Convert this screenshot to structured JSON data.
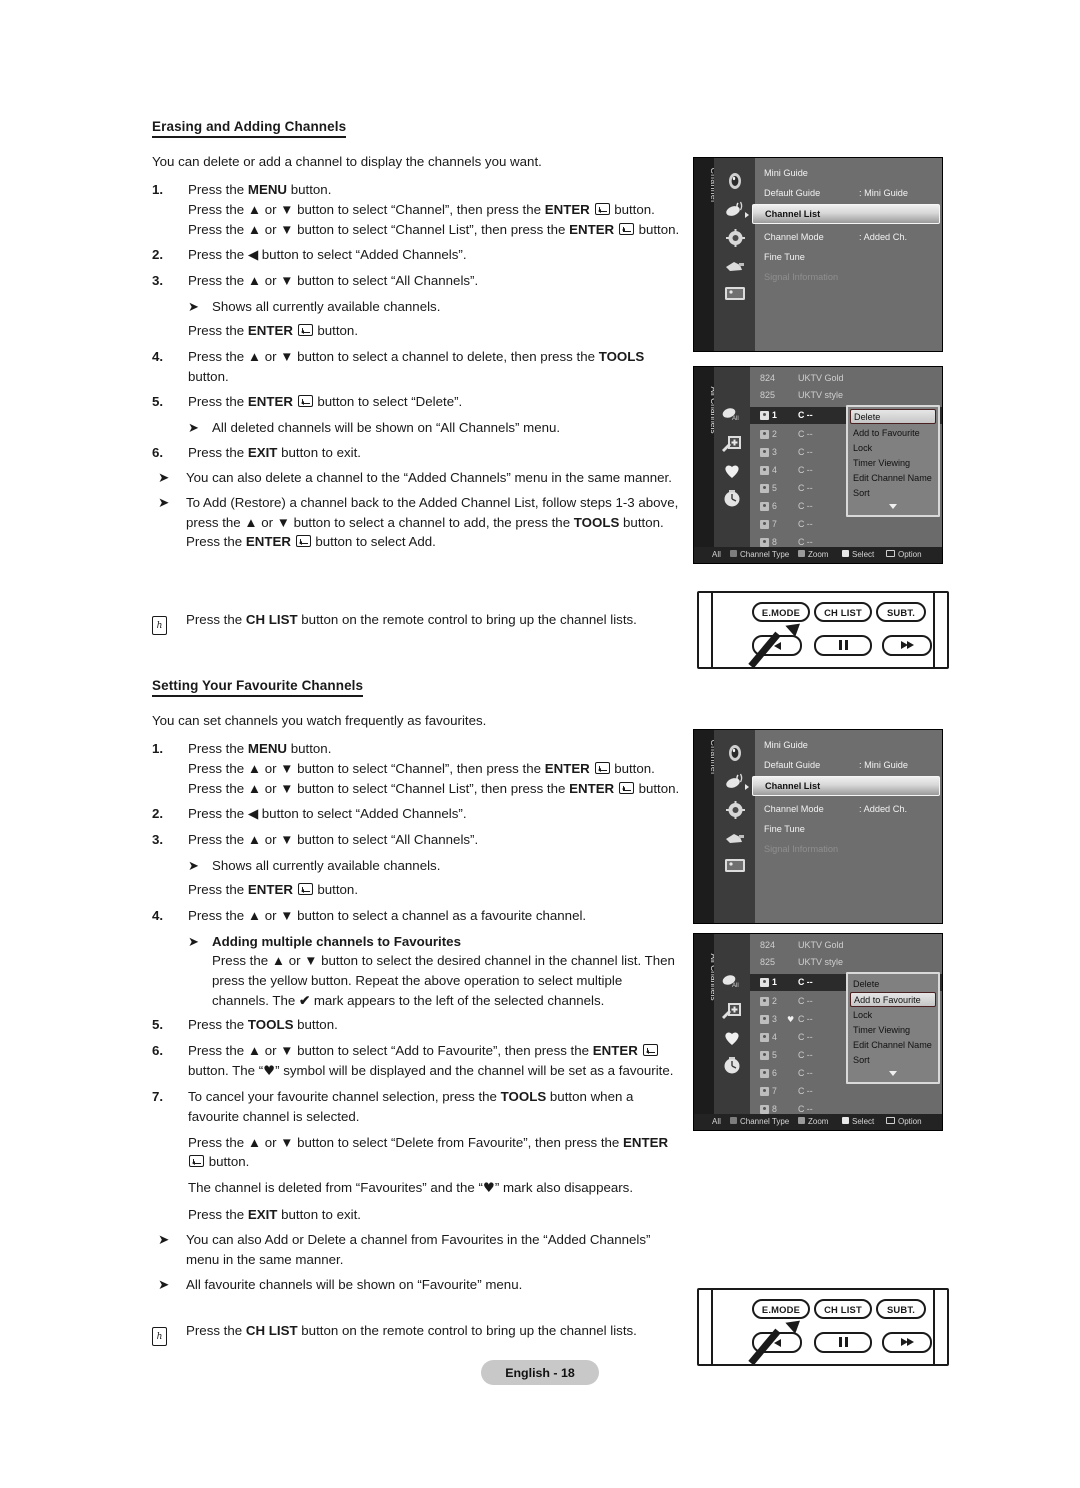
{
  "document": {
    "footer_label": "English - 18"
  },
  "section1": {
    "heading": "Erasing and Adding Channels",
    "intro": "You can delete or add a channel to display the channels you want.",
    "steps": [
      {
        "num": "1.",
        "lines": [
          "Press the MENU button.",
          "Press the ▲ or ▼ button to select “Channel”, then press the ENTER ↵ button. Press the ▲ or ▼ button to select “Channel List”, then press the ENTER ↵ button."
        ]
      },
      {
        "num": "2.",
        "lines": [
          "Press the ◀ button to select “Added Channels”."
        ]
      },
      {
        "num": "3.",
        "lines": [
          "Press the ▲ or ▼ button to select “All Channels”."
        ]
      },
      {
        "num": "4.",
        "lines": [
          "Press the ▲ or ▼ button to select a channel to delete, then press the TOOLS button."
        ]
      },
      {
        "num": "5.",
        "lines": [
          "Press the ENTER ↵ button to select “Delete”."
        ]
      },
      {
        "num": "6.",
        "lines": [
          "Press the EXIT button to exit."
        ]
      }
    ],
    "sub_step3_note": "Shows all currently available channels.",
    "sub_step3_after": "Press the ENTER ↵ button.",
    "sub_step5_note": "All deleted channels will be shown on “All Channels” menu.",
    "notes": [
      "You can also delete a channel to the “Added Channels” menu in the same manner.",
      "To Add (Restore) a channel back to the Added Channel List, follow steps 1-3 above, press the ▲ or ▼ button to select a channel to add, the press the TOOLS button. Press the ENTER ↵ button to select Add."
    ],
    "chlist_note": "Press the CH LIST button on the remote control to bring up the channel lists."
  },
  "section2": {
    "heading": "Setting Your Favourite Channels",
    "intro": "You can set channels you watch frequently as favourites.",
    "steps": [
      {
        "num": "1.",
        "lines": [
          "Press the MENU button.",
          "Press the ▲ or ▼ button to select “Channel”, then press the ENTER ↵ button. Press the ▲ or ▼ button to select “Channel List”, then press the ENTER ↵ button."
        ]
      },
      {
        "num": "2.",
        "lines": [
          "Press the ◀ button to select “Added Channels”."
        ]
      },
      {
        "num": "3.",
        "lines": [
          "Press the ▲ or ▼ button to select “All Channels”."
        ]
      },
      {
        "num": "4.",
        "lines": [
          "Press the ▲ or ▼ button to select a channel as a favourite channel."
        ]
      },
      {
        "num": "5.",
        "lines": [
          "Press the TOOLS button."
        ]
      },
      {
        "num": "6.",
        "lines": [
          "Press the ▲ or ▼ button to select “Add to Favourite”, then press the ENTER ↵ button. The “♥” symbol will be displayed and the channel will be set as a favourite."
        ]
      },
      {
        "num": "7.",
        "lines": [
          "To cancel your favourite channel selection, press the TOOLS button when a favourite channel is selected."
        ]
      }
    ],
    "sub_step3_note": "Shows all currently available channels.",
    "sub_step3_after": "Press the ENTER ↵ button.",
    "sub_step4_title": "Adding multiple channels to Favourites",
    "sub_step4_body": "Press the ▲ or ▼ button to select the desired channel in the channel list. Then press the yellow button. Repeat the above operation to select multiple channels. The ✔ mark appears to the left of the selected channels.",
    "step7_follow1": "Press the ▲ or ▼ button to select “Delete from Favourite”, then press the ENTER ↵ button.",
    "step7_follow2": "The channel is deleted from “Favourites” and the “♥” mark also disappears.",
    "step7_follow3": "Press the EXIT button to exit.",
    "notes": [
      "You can also Add or Delete a channel from Favourites in the “Added Channels” menu in the same manner.",
      "All favourite channels will be shown on “Favourite” menu."
    ],
    "chlist_note": "Press the CH LIST button on the remote control to bring up the channel lists."
  },
  "osd_menu": {
    "tab_label": "Channel",
    "icons": [
      "tv-guide-icon",
      "antenna-icon",
      "gear-icon",
      "plug-icon",
      "picture-icon"
    ],
    "rows": [
      {
        "label": "Mini Guide",
        "value": "",
        "state": "normal"
      },
      {
        "label": "Default Guide",
        "value": ": Mini Guide",
        "state": "normal"
      },
      {
        "label": "Channel List",
        "value": "",
        "state": "selected"
      },
      {
        "label": "Channel Mode",
        "value": ": Added Ch.",
        "state": "normal"
      },
      {
        "label": "Fine Tune",
        "value": "",
        "state": "normal"
      },
      {
        "label": "Signal Information",
        "value": "",
        "state": "disabled"
      }
    ]
  },
  "osd_list": {
    "tab_label": "All Channels",
    "icons": [
      "all-channels-icon",
      "added-channels-icon",
      "favourite-icon",
      "timer-icon"
    ],
    "header_rows": [
      {
        "number": "824",
        "name": "UKTV Gold"
      },
      {
        "number": "825",
        "name": "UKTV style"
      }
    ],
    "channels_a": [
      {
        "number": "1",
        "code": "C --",
        "current": true,
        "fav": ""
      },
      {
        "number": "2",
        "code": "C --",
        "current": false,
        "fav": ""
      },
      {
        "number": "3",
        "code": "C --",
        "current": false,
        "fav": ""
      },
      {
        "number": "4",
        "code": "C --",
        "current": false,
        "fav": ""
      },
      {
        "number": "5",
        "code": "C --",
        "current": false,
        "fav": ""
      },
      {
        "number": "6",
        "code": "C --",
        "current": false,
        "fav": ""
      },
      {
        "number": "7",
        "code": "C --",
        "current": false,
        "fav": ""
      },
      {
        "number": "8",
        "code": "C --",
        "current": false,
        "fav": ""
      }
    ],
    "channels_b": [
      {
        "number": "1",
        "code": "C --",
        "current": true,
        "fav": ""
      },
      {
        "number": "2",
        "code": "C --",
        "current": false,
        "fav": ""
      },
      {
        "number": "3",
        "code": "C --",
        "current": false,
        "fav": "♥"
      },
      {
        "number": "4",
        "code": "C --",
        "current": false,
        "fav": ""
      },
      {
        "number": "5",
        "code": "C --",
        "current": false,
        "fav": ""
      },
      {
        "number": "6",
        "code": "C --",
        "current": false,
        "fav": ""
      },
      {
        "number": "7",
        "code": "C --",
        "current": false,
        "fav": ""
      },
      {
        "number": "8",
        "code": "C --",
        "current": false,
        "fav": ""
      }
    ],
    "popup_items": [
      "Delete",
      "Add to Favourite",
      "Lock",
      "Timer Viewing",
      "Edit Channel Name",
      "Sort"
    ],
    "popup_highlight_a": "Delete",
    "popup_highlight_b": "Add to Favourite",
    "statusbar": [
      {
        "label": "All",
        "swatch": ""
      },
      {
        "label": "Channel Type",
        "swatch": "#7d7d7d"
      },
      {
        "label": "Zoom",
        "swatch": "#9a9a9a"
      },
      {
        "label": "Select",
        "swatch": "#e8e8e8"
      },
      {
        "label": "Option",
        "swatch": "icon"
      }
    ]
  },
  "remote": {
    "row1": [
      "E.MODE",
      "CH LIST",
      "SUBT."
    ],
    "row2_icons": [
      "rewind-icon",
      "pause-icon",
      "fast-forward-icon"
    ]
  }
}
